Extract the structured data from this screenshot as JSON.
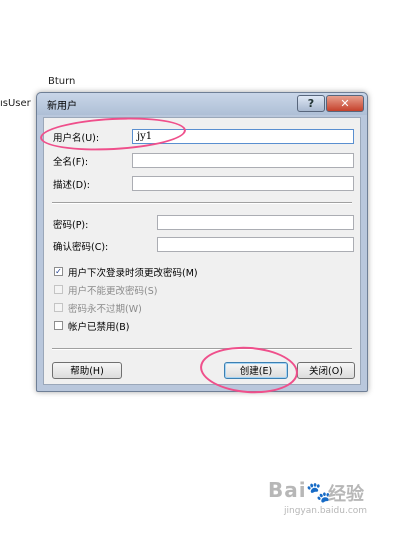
{
  "background": {
    "text_top": "Bturn",
    "text_left": "ısUser"
  },
  "dialog": {
    "title": "新用户",
    "help_title_button": "?",
    "close_title_button": "✕",
    "fields": {
      "username_label": "用户名(U):",
      "username_value": "jy1",
      "fullname_label": "全名(F):",
      "fullname_value": "",
      "description_label": "描述(D):",
      "description_value": "",
      "password_label": "密码(P):",
      "password_value": "",
      "confirm_label": "确认密码(C):",
      "confirm_value": ""
    },
    "options": [
      {
        "label": "用户下次登录时须更改密码(M)",
        "checked": true,
        "enabled": true
      },
      {
        "label": "用户不能更改密码(S)",
        "checked": false,
        "enabled": false
      },
      {
        "label": "密码永不过期(W)",
        "checked": false,
        "enabled": false
      },
      {
        "label": "帐户已禁用(B)",
        "checked": false,
        "enabled": true
      }
    ],
    "buttons": {
      "help": "帮助(H)",
      "create": "创建(E)",
      "close": "关闭(O)"
    },
    "check_mark": "✓"
  },
  "watermark": {
    "logo": "Bai",
    "logo_icon": "paw-icon",
    "logo_cn": "经验",
    "url": "jingyan.baidu.com"
  },
  "colors": {
    "annotation": "#ef4f8b",
    "title_bar": "#b9c7dc"
  }
}
